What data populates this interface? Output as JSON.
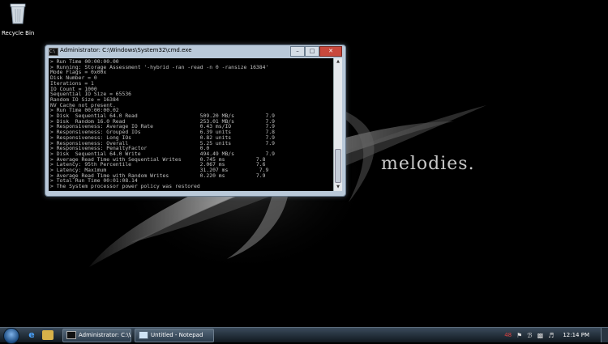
{
  "desktop": {
    "recycle_bin_label": "Recycle Bin",
    "wallpaper_text": "melodies."
  },
  "cmd": {
    "title": "Administrator: C:\\Windows\\System32\\cmd.exe",
    "lines": [
      "> Run Time 00:00:00.00",
      "> Running: Storage Assessment '-hybrid -ran -read -n 0 -ransize 16384'",
      "Mode Flags = 0x00x",
      "Disk Number = 0",
      "Iterations = 1",
      "IO Count = 1000",
      "Sequential IO Size = 65536",
      "Random IO Size = 16384",
      "NV Cache not present.",
      "> Run Time 00:00:00.02",
      "> Disk  Sequential 64.0 Read                    509.20 MB/s          7.9",
      "> Disk  Random 16.0 Read                        253.01 MB/s          7.9",
      "> Responsiveness: Average IO Rate               0.43 ms/IO           7.9",
      "> Responsiveness: Grouped IOs                   6.39 units           7.8",
      "> Responsiveness: Long IOs                      0.82 units           7.9",
      "> Responsiveness: Overall                       5.25 units           7.9",
      "> Responsiveness: PenaltyFactor                 0.0",
      "> Disk  Sequential 64.0 Write                   494.49 MB/s          7.9",
      "> Average Read Time with Sequential Writes      0.745 ms          7.8",
      "> Latency: 95th Percentile                      2.067 ms          7.6",
      "> Latency: Maximum                              31.207 ms          7.9",
      "> Average Read Time with Random Writes          0.220 ms          7.9",
      "> Total Run Time 00:01:08.14",
      "> The System processor power policy was restored"
    ]
  },
  "taskbar": {
    "tasks": [
      {
        "label": "Administrator: C:\\Wi..."
      },
      {
        "label": "Untitled - Notepad"
      }
    ],
    "tray_badge": "48",
    "clock": "12:14 PM"
  }
}
